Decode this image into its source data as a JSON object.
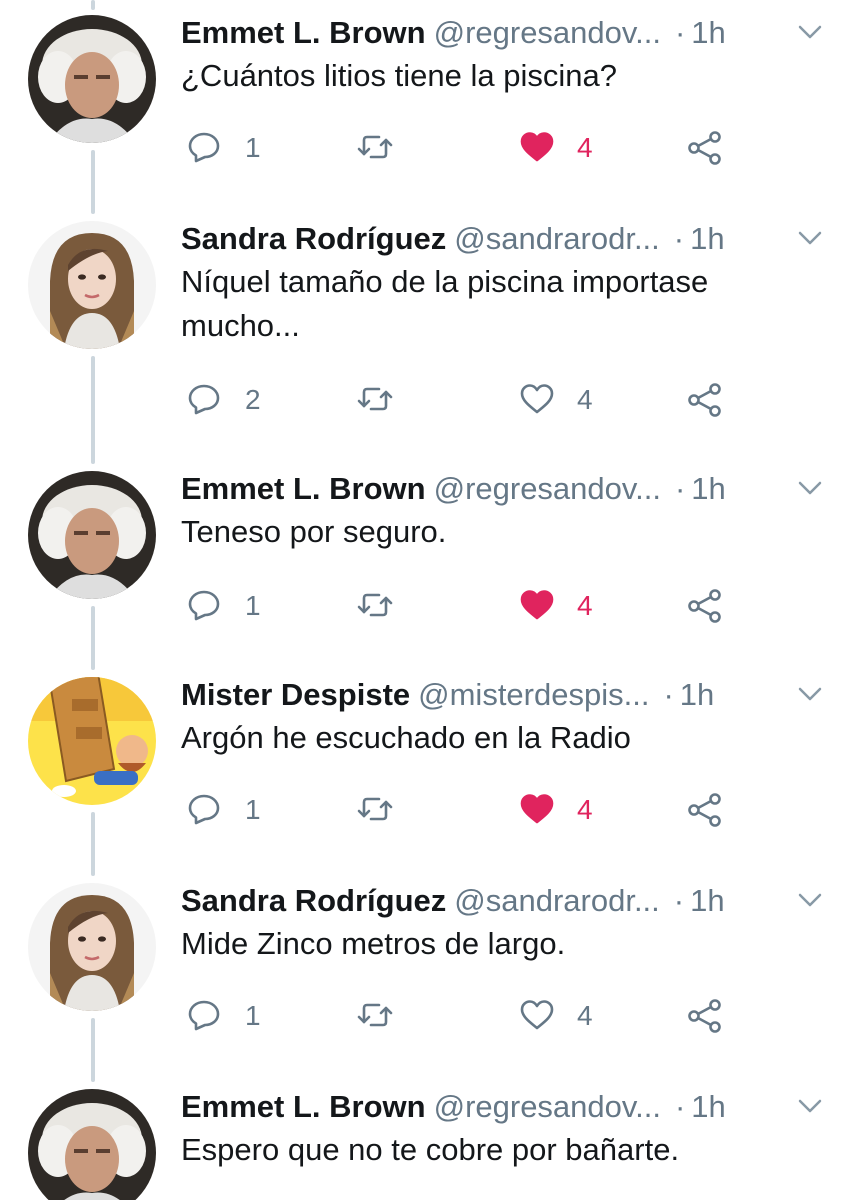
{
  "colors": {
    "text": "#14171a",
    "secondary": "#657786",
    "like": "#e0245e",
    "thread_line": "#ccd6dd"
  },
  "tweets": [
    {
      "name": "Emmet L. Brown",
      "handle": "@regresandov...",
      "separator": "·",
      "time": "1h",
      "text": "¿Cuántos litios tiene la piscina?",
      "replies": "1",
      "retweets": "",
      "likes": "4",
      "liked": true,
      "avatar": "doc-brown-avatar"
    },
    {
      "name": "Sandra Rodríguez",
      "handle": "@sandrarodr...",
      "separator": "·",
      "time": "1h",
      "text": "Níquel tamaño de la piscina importase mucho...",
      "replies": "2",
      "retweets": "",
      "likes": "4",
      "liked": false,
      "avatar": "sandra-avatar"
    },
    {
      "name": "Emmet L. Brown",
      "handle": "@regresandov...",
      "separator": "·",
      "time": "1h",
      "text": "Teneso por seguro.",
      "replies": "1",
      "retweets": "",
      "likes": "4",
      "liked": true,
      "avatar": "doc-brown-avatar"
    },
    {
      "name": "Mister Despiste",
      "handle": "@misterdespis...",
      "separator": "·",
      "time": "1h",
      "text": "Argón he escuchado en la Radio",
      "replies": "1",
      "retweets": "",
      "likes": "4",
      "liked": true,
      "avatar": "mister-despiste-avatar"
    },
    {
      "name": "Sandra Rodríguez",
      "handle": "@sandrarodr...",
      "separator": "·",
      "time": "1h",
      "text": "Mide Zinco metros de largo.",
      "replies": "1",
      "retweets": "",
      "likes": "4",
      "liked": false,
      "avatar": "sandra-avatar"
    },
    {
      "name": "Emmet L. Brown",
      "handle": "@regresandov...",
      "separator": "·",
      "time": "1h",
      "text": "Espero que no te cobre por bañarte.",
      "replies": "",
      "retweets": "",
      "likes": "",
      "liked": false,
      "avatar": "doc-brown-avatar"
    }
  ]
}
